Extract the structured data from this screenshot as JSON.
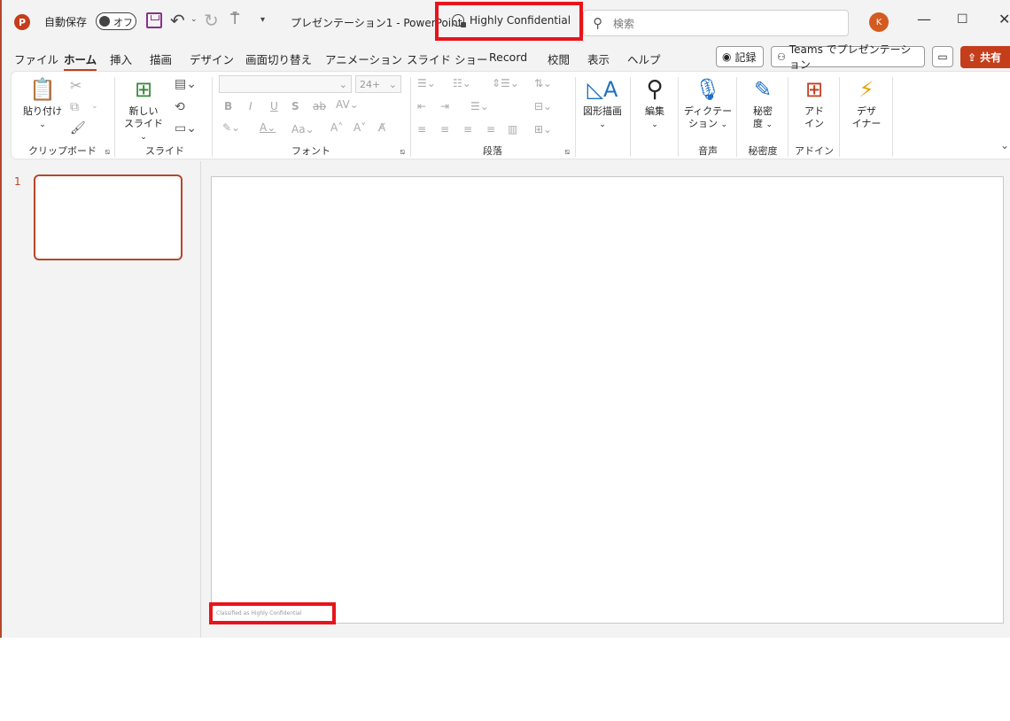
{
  "titlebar": {
    "app_icon": "P",
    "autosave_label": "自動保存",
    "autosave_state": "オフ",
    "doc_title": "プレゼンテーション1  -  PowerPoint",
    "sensitivity_label": "Highly Confidential",
    "search_placeholder": "検索",
    "avatar_initial": "K"
  },
  "tabs": [
    "ファイル",
    "ホーム",
    "挿入",
    "描画",
    "デザイン",
    "画面切り替え",
    "アニメーション",
    "スライド ショー",
    "Record",
    "校閲",
    "表示",
    "ヘルプ"
  ],
  "tab_active_index": 1,
  "right_buttons": {
    "record": "記録",
    "teams": "Teams でプレゼンテーション",
    "share": "共有"
  },
  "ribbon": {
    "clipboard": {
      "paste": "貼り付け",
      "label": "クリップボード"
    },
    "slides": {
      "new_slide_line1": "新しい",
      "new_slide_line2": "スライド",
      "label": "スライド"
    },
    "font": {
      "size": "24+",
      "bold": "B",
      "italic": "I",
      "underline": "U",
      "shadow": "S",
      "strike": "ab",
      "spacing": "AV",
      "case": "Aa",
      "grow": "A",
      "shrink": "A",
      "label": "フォント"
    },
    "paragraph": {
      "label": "段落"
    },
    "drawing": {
      "shapes": "図形描画"
    },
    "editing": {
      "edit": "編集"
    },
    "voice": {
      "dictate_line1": "ディクテー",
      "dictate_line2": "ション",
      "label": "音声"
    },
    "sensitivity": {
      "btn_line1": "秘密",
      "btn_line2": "度",
      "label": "秘密度"
    },
    "addins": {
      "btn_line1": "アド",
      "btn_line2": "イン",
      "label": "アドイン"
    },
    "designer": {
      "btn_line1": "デザ",
      "btn_line2": "イナー"
    }
  },
  "slides_pane": {
    "thumb_number": "1"
  },
  "slide": {
    "footer_text": "Classified as Highly Confidential"
  },
  "colors": {
    "accent": "#c43e1c",
    "highlight": "#e8141b"
  }
}
